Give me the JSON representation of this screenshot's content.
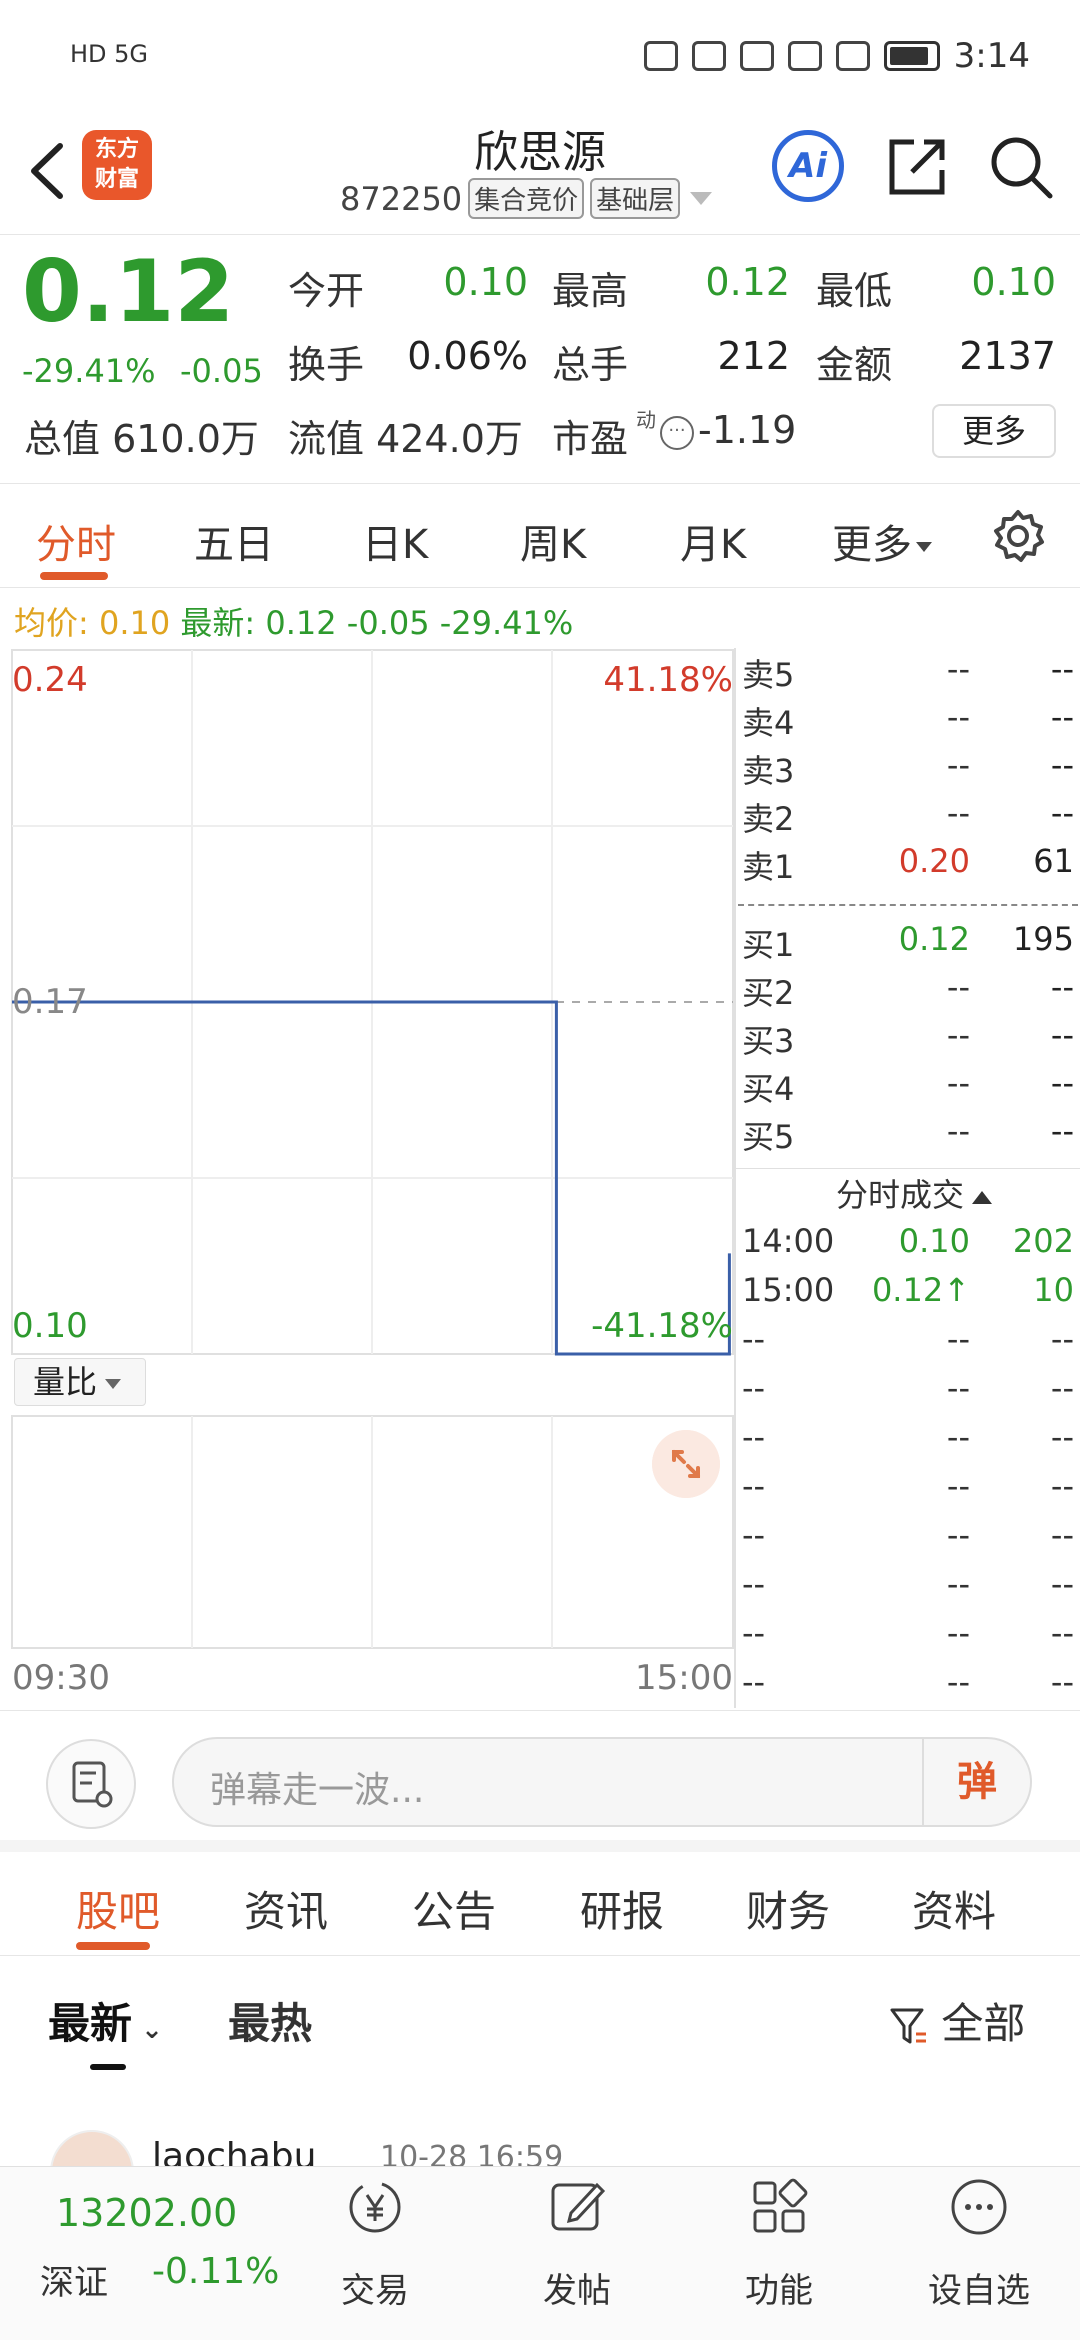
{
  "status": {
    "left": "HD 5G",
    "time": "3:14"
  },
  "header": {
    "title": "欣思源",
    "code": "872250",
    "tags": [
      "集合竞价",
      "基础层"
    ],
    "logo": "东方\n财富",
    "ai": "Ai"
  },
  "quote": {
    "price": "0.12",
    "change_pct": "-29.41%",
    "change": "-0.05",
    "today_open_label": "今开",
    "today_open": "0.10",
    "high_label": "最高",
    "high": "0.12",
    "low_label": "最低",
    "low": "0.10",
    "turnover_label": "换手",
    "turnover": "0.06%",
    "volume_label": "总手",
    "volume": "212",
    "amount_label": "金额",
    "amount": "2137",
    "mcap": "总值 610.0万",
    "float_mcap": "流值 424.0万",
    "pe_label": "市盈",
    "pe_sup": "动",
    "pe": "-1.19",
    "more": "更多"
  },
  "tabs": [
    "分时",
    "五日",
    "日K",
    "周K",
    "月K",
    "更多"
  ],
  "info": {
    "avg_label": "均价:",
    "avg": "0.10",
    "last_label": "最新:",
    "last": "0.12",
    "chg": "-0.05",
    "pct": "-29.41%"
  },
  "chart_data": {
    "type": "line",
    "x_labels": [
      "09:30",
      "15:00"
    ],
    "y_labels": {
      "top": "0.24",
      "mid": "0.17",
      "bottom": "0.10"
    },
    "pct_labels": {
      "top": "41.18%",
      "bottom": "-41.18%"
    },
    "ylim": [
      0.1,
      0.24
    ],
    "prev_close": 0.17,
    "series": [
      {
        "points": [
          [
            0,
            0.17
          ],
          [
            0.755,
            0.17
          ],
          [
            0.755,
            0.1
          ],
          [
            0.995,
            0.1
          ],
          [
            0.995,
            0.12
          ]
        ]
      }
    ],
    "grid": true
  },
  "ratio_label": "量比",
  "book": {
    "asks": [
      {
        "label": "卖5",
        "price": "--",
        "vol": "--"
      },
      {
        "label": "卖4",
        "price": "--",
        "vol": "--"
      },
      {
        "label": "卖3",
        "price": "--",
        "vol": "--"
      },
      {
        "label": "卖2",
        "price": "--",
        "vol": "--"
      },
      {
        "label": "卖1",
        "price": "0.20",
        "vol": "61"
      }
    ],
    "bids": [
      {
        "label": "买1",
        "price": "0.12",
        "vol": "195"
      },
      {
        "label": "买2",
        "price": "--",
        "vol": "--"
      },
      {
        "label": "买3",
        "price": "--",
        "vol": "--"
      },
      {
        "label": "买4",
        "price": "--",
        "vol": "--"
      },
      {
        "label": "买5",
        "price": "--",
        "vol": "--"
      }
    ],
    "trades_title": "分时成交",
    "trades": [
      {
        "time": "14:00",
        "price": "0.10",
        "vol": "202"
      },
      {
        "time": "15:00",
        "price": "0.12↑",
        "vol": "10"
      },
      {
        "time": "--",
        "price": "--",
        "vol": "--"
      },
      {
        "time": "--",
        "price": "--",
        "vol": "--"
      },
      {
        "time": "--",
        "price": "--",
        "vol": "--"
      },
      {
        "time": "--",
        "price": "--",
        "vol": "--"
      },
      {
        "time": "--",
        "price": "--",
        "vol": "--"
      },
      {
        "time": "--",
        "price": "--",
        "vol": "--"
      },
      {
        "time": "--",
        "price": "--",
        "vol": "--"
      },
      {
        "time": "--",
        "price": "--",
        "vol": "--"
      }
    ]
  },
  "danmu": {
    "placeholder": "弹幕走一波...",
    "button": "弹"
  },
  "subtabs": [
    "股吧",
    "资讯",
    "公告",
    "研报",
    "财务",
    "资料"
  ],
  "filter": {
    "latest": "最新",
    "hot": "最热",
    "all": "全部"
  },
  "post": {
    "user": "laochabu",
    "time": "10-28 16:59"
  },
  "bottom": {
    "index_value": "13202.00",
    "index_name": "深证",
    "index_chg": "-0.11%",
    "nav": [
      "交易",
      "发帖",
      "功能",
      "设自选"
    ]
  },
  "colors": {
    "up": "#d23b2b",
    "down": "#2e9a2e",
    "accent": "#e05a2a",
    "line": "#3a5fa8"
  }
}
